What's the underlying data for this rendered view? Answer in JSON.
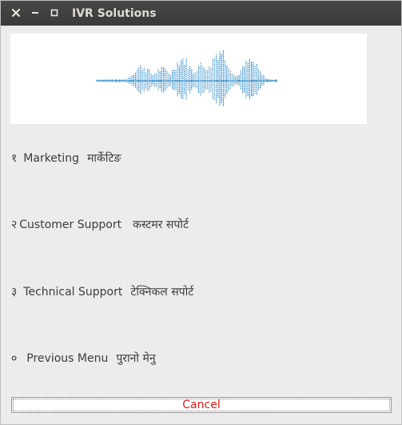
{
  "window": {
    "title": "IVR Solutions",
    "titlebar_bg": "#3c3c3c",
    "controls": [
      "close-icon",
      "minimize-icon",
      "maximize-icon"
    ]
  },
  "banner": {
    "icon": "sound-waveform",
    "color": "#1d7fbf"
  },
  "menu": {
    "items": [
      {
        "num": "१",
        "en": "Marketing",
        "hi": "मार्केटिङ"
      },
      {
        "num": "२",
        "en": "Customer Support",
        "hi": "कस्टमर सपोर्ट"
      },
      {
        "num": "३",
        "en": "Technical Support",
        "hi": "टेक्निकल सपोर्ट"
      },
      {
        "num": "०",
        "en": "Previous Menu",
        "hi": "पुरानो मेनु"
      }
    ]
  },
  "cancel_button": {
    "label": "Cancel",
    "text_color": "#e01a1a"
  }
}
